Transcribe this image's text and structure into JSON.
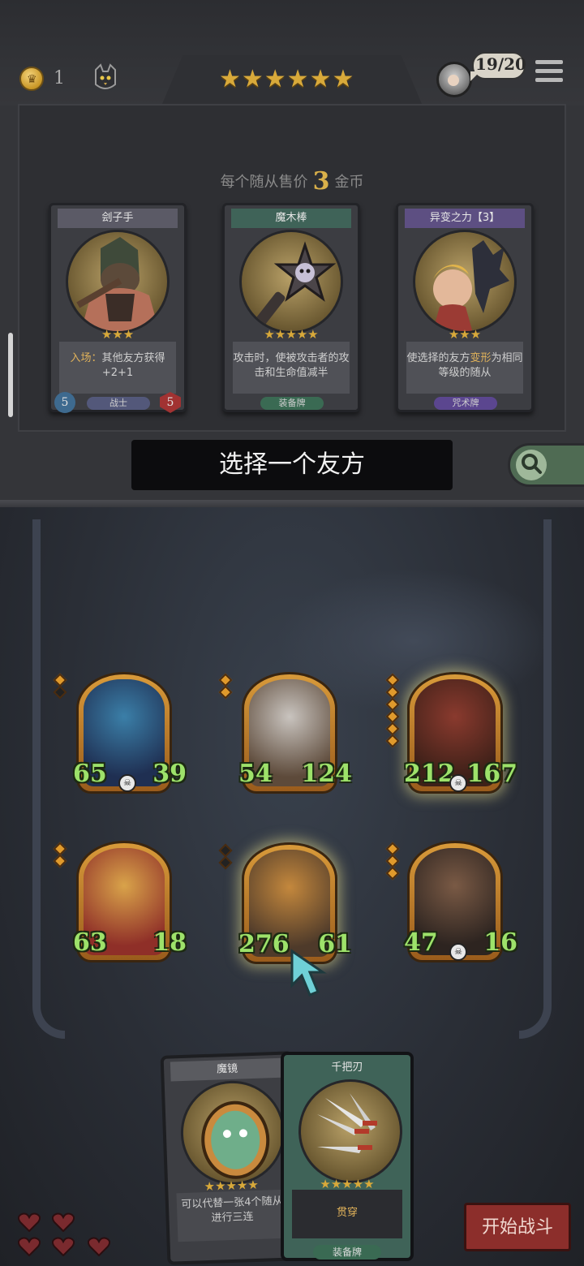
{
  "hud": {
    "gold": "1",
    "tier_stars": "★★★★★★",
    "player_count": "19/20",
    "colors": {
      "gold": "#d8a93a",
      "stat_green": "#9de26a",
      "accent_red": "#8c2e2b"
    }
  },
  "shop": {
    "price_prefix": "每个随从售价",
    "price_value": "3",
    "price_suffix": "金币",
    "cards": [
      {
        "title": "刽子手",
        "stars": "★★★",
        "text_hl": "入场：",
        "text": "其他友方获得+2+1",
        "type": "战士",
        "attack": "5",
        "health": "5"
      },
      {
        "title": "魔木棒",
        "stars": "★★★★★",
        "text": "攻击时，使被攻击者的攻击和生命值减半",
        "type": "装备牌"
      },
      {
        "title": "异变之力【3】",
        "stars": "★★★",
        "text_pre": "使选择的友方",
        "text_hl": "变形",
        "text_post": "为相同等级的随从",
        "type": "咒术牌"
      }
    ]
  },
  "prompt": "选择一个友方",
  "board": {
    "units": [
      {
        "name": "elf-sorceress",
        "attack": "65",
        "health": "39",
        "tier": 1
      },
      {
        "name": "old-scientist",
        "attack": "54",
        "health": "124",
        "tier": 2
      },
      {
        "name": "red-ogre",
        "attack": "212",
        "health": "167",
        "tier": 6
      },
      {
        "name": "red-knight",
        "attack": "63",
        "health": "18",
        "tier": 2
      },
      {
        "name": "pirate-captain",
        "attack": "276",
        "health": "61",
        "tier": 0
      },
      {
        "name": "barbarian",
        "attack": "47",
        "health": "16",
        "tier": 3
      }
    ]
  },
  "hand": {
    "cards": [
      {
        "title": "魔镜",
        "stars": "★★★★★",
        "text": "可以代替一张4个随从进行三连",
        "type": ""
      },
      {
        "title": "千把刃",
        "stars": "★★★★★",
        "text": "贯穿",
        "type": "装备牌"
      }
    ]
  },
  "lives": 5,
  "start_button": "开始战斗"
}
